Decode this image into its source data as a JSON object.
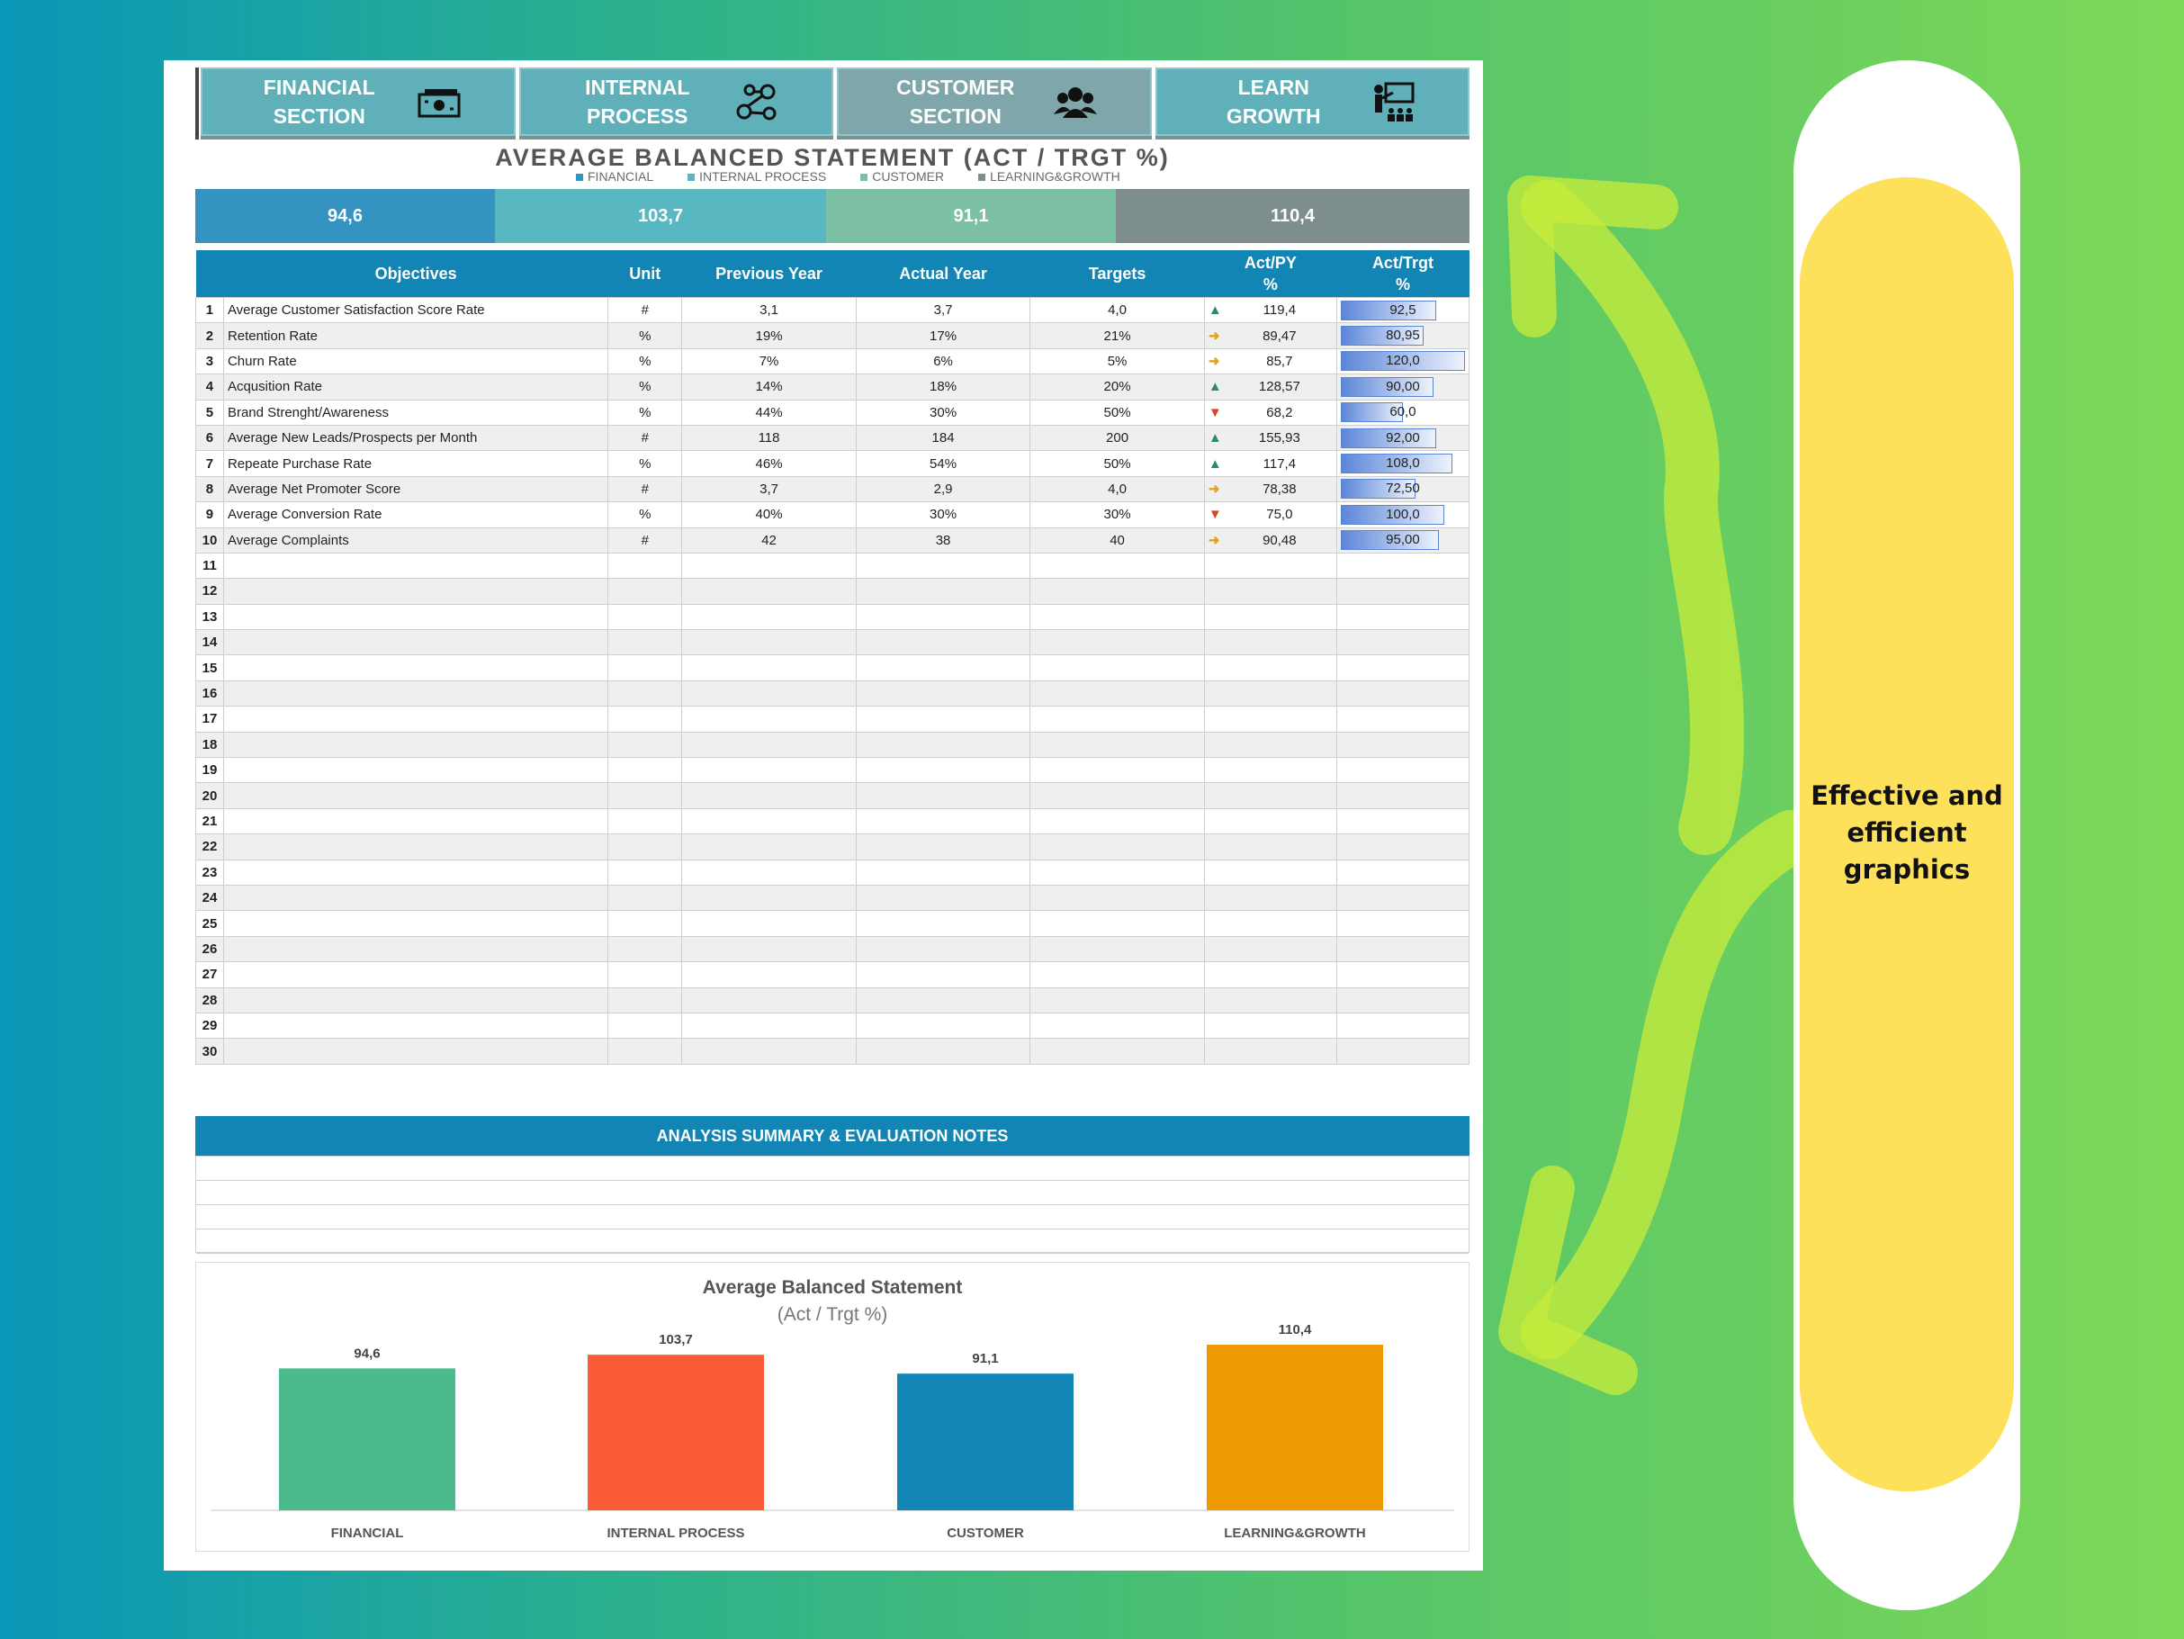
{
  "nav": [
    {
      "label": "FINANCIAL\nSECTION",
      "icon": "money-icon"
    },
    {
      "label": "INTERNAL\nPROCESS",
      "icon": "network-icon"
    },
    {
      "label": "CUSTOMER\nSECTION",
      "icon": "people-icon"
    },
    {
      "label": "LEARN\nGROWTH",
      "icon": "teacher-board-icon"
    }
  ],
  "statement": {
    "title": "AVERAGE BALANCED STATEMENT (ACT / TRGT %)",
    "legend": [
      "FINANCIAL",
      "INTERNAL PROCESS",
      "CUSTOMER",
      "LEARNING&GROWTH"
    ],
    "kpis": [
      {
        "name": "FINANCIAL",
        "value": "94,6",
        "color": "#3493c1"
      },
      {
        "name": "INTERNAL PROCESS",
        "value": "103,7",
        "color": "#59b7c2"
      },
      {
        "name": "CUSTOMER",
        "value": "91,1",
        "color": "#7cc1a5"
      },
      {
        "name": "LEARNING&GROWTH",
        "value": "110,4",
        "color": "#7e8e8f"
      }
    ]
  },
  "table": {
    "headers": {
      "objectives": "Objectives",
      "unit": "Unit",
      "prev": "Previous Year",
      "actual": "Actual Year",
      "targets": "Targets",
      "act_py": "Act/PY\n%",
      "act_trgt": "Act/Trgt\n%"
    },
    "rows": [
      {
        "n": "1",
        "objective": "Average Customer Satisfaction Score Rate",
        "unit": "#",
        "prev": "3,1",
        "actual": "3,7",
        "target": "4,0",
        "trend": "up",
        "act_py": "119,4",
        "act_trgt": "92,5",
        "bar": 0.77
      },
      {
        "n": "2",
        "objective": "Retention Rate",
        "unit": "%",
        "prev": "19%",
        "actual": "17%",
        "target": "21%",
        "trend": "flat",
        "act_py": "89,47",
        "act_trgt": "80,95",
        "bar": 0.67
      },
      {
        "n": "3",
        "objective": "Churn Rate",
        "unit": "%",
        "prev": "7%",
        "actual": "6%",
        "target": "5%",
        "trend": "flat",
        "act_py": "85,7",
        "act_trgt": "120,0",
        "bar": 1.0
      },
      {
        "n": "4",
        "objective": "Acqusition Rate",
        "unit": "%",
        "prev": "14%",
        "actual": "18%",
        "target": "20%",
        "trend": "up",
        "act_py": "128,57",
        "act_trgt": "90,00",
        "bar": 0.75
      },
      {
        "n": "5",
        "objective": "Brand Strenght/Awareness",
        "unit": "%",
        "prev": "44%",
        "actual": "30%",
        "target": "50%",
        "trend": "down",
        "act_py": "68,2",
        "act_trgt": "60,0",
        "bar": 0.5
      },
      {
        "n": "6",
        "objective": "Average New Leads/Prospects per Month",
        "unit": "#",
        "prev": "118",
        "actual": "184",
        "target": "200",
        "trend": "up",
        "act_py": "155,93",
        "act_trgt": "92,00",
        "bar": 0.77
      },
      {
        "n": "7",
        "objective": "Repeate Purchase Rate",
        "unit": "%",
        "prev": "46%",
        "actual": "54%",
        "target": "50%",
        "trend": "up",
        "act_py": "117,4",
        "act_trgt": "108,0",
        "bar": 0.9
      },
      {
        "n": "8",
        "objective": "Average Net Promoter Score",
        "unit": "#",
        "prev": "3,7",
        "actual": "2,9",
        "target": "4,0",
        "trend": "flat",
        "act_py": "78,38",
        "act_trgt": "72,50",
        "bar": 0.6
      },
      {
        "n": "9",
        "objective": "Average Conversion Rate",
        "unit": "%",
        "prev": "40%",
        "actual": "30%",
        "target": "30%",
        "trend": "down",
        "act_py": "75,0",
        "act_trgt": "100,0",
        "bar": 0.83
      },
      {
        "n": "10",
        "objective": "Average Complaints",
        "unit": "#",
        "prev": "42",
        "actual": "38",
        "target": "40",
        "trend": "flat",
        "act_py": "90,48",
        "act_trgt": "95,00",
        "bar": 0.79
      },
      {
        "n": "11"
      },
      {
        "n": "12"
      },
      {
        "n": "13"
      },
      {
        "n": "14"
      },
      {
        "n": "15"
      },
      {
        "n": "16"
      },
      {
        "n": "17"
      },
      {
        "n": "18"
      },
      {
        "n": "19"
      },
      {
        "n": "20"
      },
      {
        "n": "21"
      },
      {
        "n": "22"
      },
      {
        "n": "23"
      },
      {
        "n": "24"
      },
      {
        "n": "25"
      },
      {
        "n": "26"
      },
      {
        "n": "27"
      },
      {
        "n": "28"
      },
      {
        "n": "29"
      },
      {
        "n": "30"
      }
    ]
  },
  "summary": {
    "title": "ANALYSIS SUMMARY & EVALUATION NOTES"
  },
  "chart_data": {
    "type": "bar",
    "title": "Average Balanced Statement",
    "subtitle": "(Act / Trgt %)",
    "categories": [
      "FINANCIAL",
      "INTERNAL PROCESS",
      "CUSTOMER",
      "LEARNING&GROWTH"
    ],
    "values": [
      94.6,
      103.7,
      91.1,
      110.4
    ],
    "labels": [
      "94,6",
      "103,7",
      "91,1",
      "110,4"
    ],
    "colors": [
      "#4cbb8b",
      "#fb5b35",
      "#1386b6",
      "#ef9a05"
    ],
    "ylim": [
      0,
      120
    ],
    "grid": false,
    "legend": "none"
  },
  "callout": {
    "text": "Effective and\nefficient\ngraphics"
  }
}
